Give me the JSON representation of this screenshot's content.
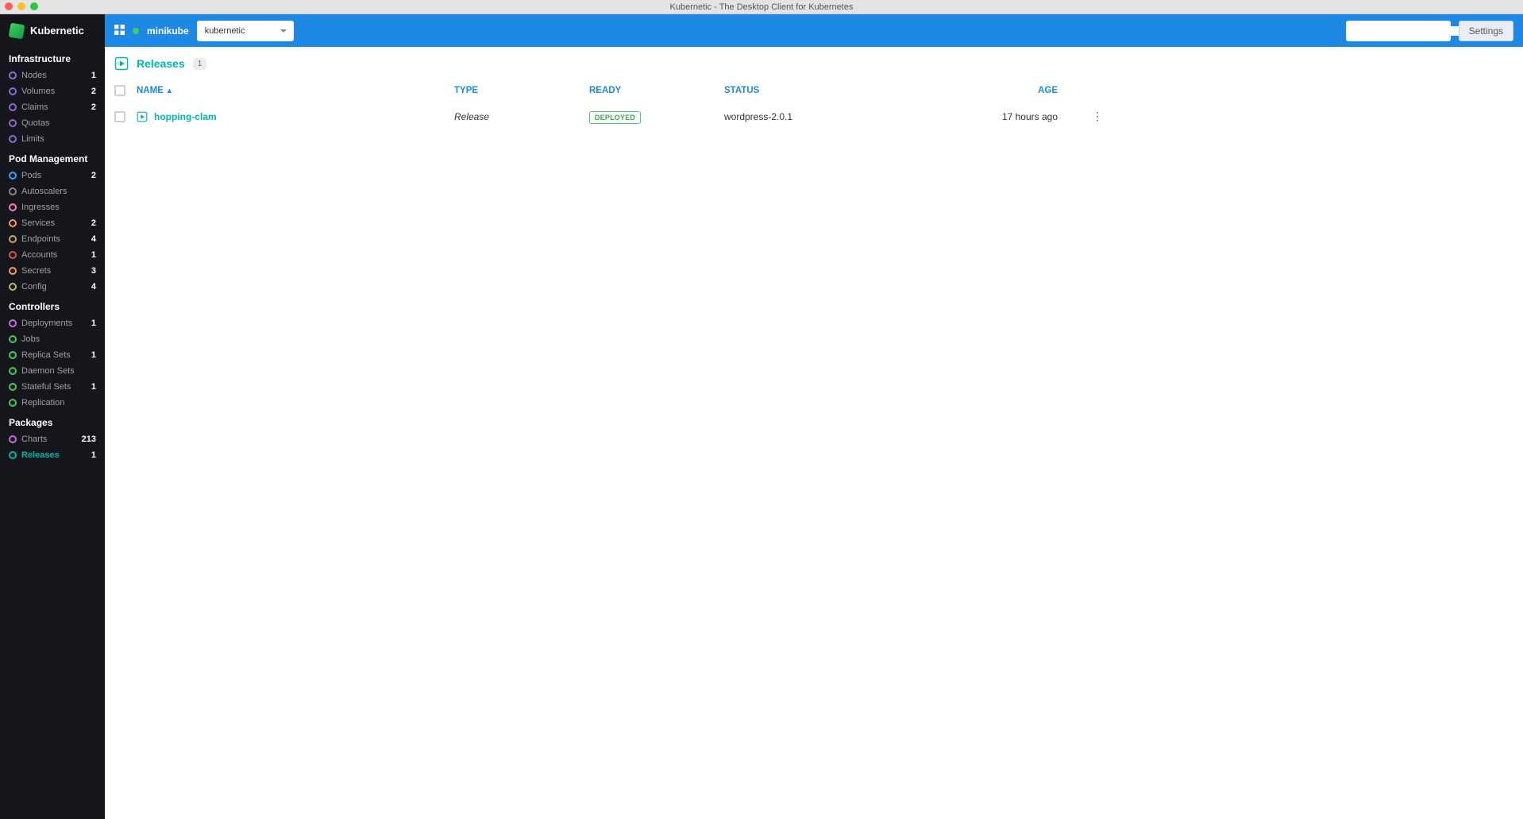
{
  "window": {
    "title": "Kubernetic - The Desktop Client for Kubernetes"
  },
  "brand": {
    "name": "Kubernetic"
  },
  "topbar": {
    "cluster": "minikube",
    "namespace": "kubernetic",
    "settings_label": "Settings",
    "search_placeholder": ""
  },
  "sidebar": {
    "sections": [
      {
        "title": "Infrastructure",
        "items": [
          {
            "label": "Nodes",
            "count": "1",
            "color": "#8e6bd6"
          },
          {
            "label": "Volumes",
            "count": "2",
            "color": "#8e6bd6"
          },
          {
            "label": "Claims",
            "count": "2",
            "color": "#8e6bd6"
          },
          {
            "label": "Quotas",
            "count": "",
            "color": "#8e6bd6"
          },
          {
            "label": "Limits",
            "count": "",
            "color": "#8e6bd6"
          }
        ]
      },
      {
        "title": "Pod Management",
        "items": [
          {
            "label": "Pods",
            "count": "2",
            "color": "#3aa0ff"
          },
          {
            "label": "Autoscalers",
            "count": "",
            "color": "#888"
          },
          {
            "label": "Ingresses",
            "count": "",
            "color": "#ff7bd0"
          },
          {
            "label": "Services",
            "count": "2",
            "color": "#ff9f4a"
          },
          {
            "label": "Endpoints",
            "count": "4",
            "color": "#d0a85a"
          },
          {
            "label": "Accounts",
            "count": "1",
            "color": "#e35050"
          },
          {
            "label": "Secrets",
            "count": "3",
            "color": "#ff9f4a"
          },
          {
            "label": "Config",
            "count": "4",
            "color": "#c8b85a"
          }
        ]
      },
      {
        "title": "Controllers",
        "items": [
          {
            "label": "Deployments",
            "count": "1",
            "color": "#d06bd6"
          },
          {
            "label": "Jobs",
            "count": "",
            "color": "#3fcf63"
          },
          {
            "label": "Replica Sets",
            "count": "1",
            "color": "#3fcf63"
          },
          {
            "label": "Daemon Sets",
            "count": "",
            "color": "#3fcf63"
          },
          {
            "label": "Stateful Sets",
            "count": "1",
            "color": "#3fcf63"
          },
          {
            "label": "Replication",
            "count": "",
            "color": "#3fcf63"
          }
        ]
      },
      {
        "title": "Packages",
        "items": [
          {
            "label": "Charts",
            "count": "213",
            "color": "#d06bd6"
          },
          {
            "label": "Releases",
            "count": "1",
            "color": "#00b8a8",
            "active": true
          }
        ]
      }
    ]
  },
  "page": {
    "title": "Releases",
    "count": "1",
    "columns": {
      "name": "NAME",
      "type": "TYPE",
      "ready": "READY",
      "status": "STATUS",
      "age": "AGE"
    },
    "rows": [
      {
        "name": "hopping-clam",
        "type": "Release",
        "ready": "DEPLOYED",
        "status": "wordpress-2.0.1",
        "age": "17 hours ago"
      }
    ]
  }
}
